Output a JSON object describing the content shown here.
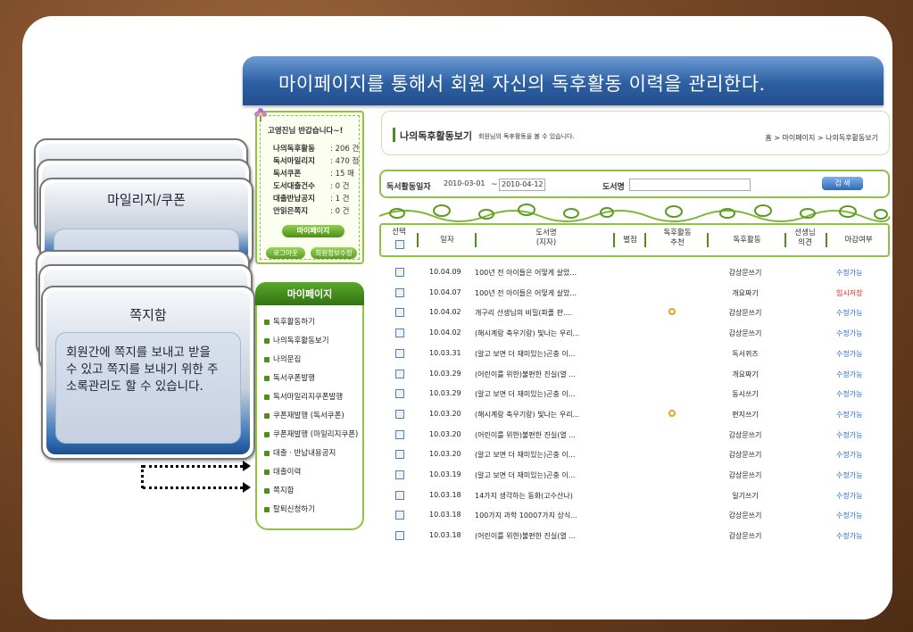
{
  "banner": {
    "title": "마이페이지를 통해서 회원 자신의 독후활동 이력을 관리한다."
  },
  "cards": [
    {
      "title": "마일리지/쿠폰",
      "description": ""
    },
    {
      "title": "쪽지함",
      "description": "회원간에 쪽지를 보내고 받을 수 있고 쪽지를 보내기 위한 주소록관리도 할 수 있습니다."
    }
  ],
  "sidebar": {
    "welcome": "고영진님 반갑습니다~!",
    "stats": [
      {
        "label": "나의독후활동",
        "value": ": 206 건"
      },
      {
        "label": "독서마일리지",
        "value": ": 470 점"
      },
      {
        "label": "독서쿠폰",
        "value": ": 15 매"
      },
      {
        "label": "도서대출건수",
        "value": ": 0 건"
      },
      {
        "label": "대출반납공지",
        "value": ": 1 건"
      },
      {
        "label": "안읽은쪽지",
        "value": ": 0 건"
      }
    ],
    "mypage_button": "마이페이지",
    "logout_button": "로그아웃",
    "edit_info_button": "회원정보수정",
    "menu_title": "마이페이지",
    "menu_items": [
      "독후활동하기",
      "나의독후활동보기",
      "나의문집",
      "독서쿠폰발행",
      "독서마일리지쿠폰발행",
      "쿠폰재발행 (독서쿠폰)",
      "쿠폰재발행 (마일리지쿠폰)",
      "대출ㆍ반납내용공지",
      "대출이력",
      "쪽지함",
      "탈퇴신청하기"
    ]
  },
  "header": {
    "title": "나의독후활동보기",
    "subtitle": "회원님의 독후활동을 볼 수 있습니다.",
    "breadcrumb": "홈 > 마이페이지 > 나의독후활동보기"
  },
  "search": {
    "period_label": "독서활동일자",
    "date_from": "2010-03-01",
    "separator": "~",
    "date_to": "2010-04-12",
    "book_label": "도서명",
    "book_value": "",
    "button": "검 색"
  },
  "table": {
    "columns": [
      "선택",
      "일자",
      "도서명\n(지자)",
      "별점",
      "독후활동\n추천",
      "독후활동",
      "선생님\n의견",
      "마감여부"
    ],
    "rows": [
      {
        "date": "10.04.09",
        "book": "100년 전 아이들은 어떻게 살았...",
        "recommended": false,
        "activity": "감상문쓰기",
        "status": "수정가능",
        "status_type": "ok"
      },
      {
        "date": "10.04.07",
        "book": "100년 전 아이들은 어떻게 살았...",
        "recommended": false,
        "activity": "개요짜기",
        "status": "임시저장",
        "status_type": "temp"
      },
      {
        "date": "10.04.02",
        "book": "개구리 선생님의 비밀(파폴 판....",
        "recommended": true,
        "activity": "감상문쓰기",
        "status": "수정가능",
        "status_type": "ok"
      },
      {
        "date": "10.04.02",
        "book": "(해시계랑 축우기랑) 빛나는 우리...",
        "recommended": false,
        "activity": "감상문쓰기",
        "status": "수정가능",
        "status_type": "ok"
      },
      {
        "date": "10.03.31",
        "book": "(알고 보면 더 재미있는)곤충 이...",
        "recommended": false,
        "activity": "독서퀴즈",
        "status": "수정가능",
        "status_type": "ok"
      },
      {
        "date": "10.03.29",
        "book": "(어린이를 위한)불편한 진실(열 ...",
        "recommended": false,
        "activity": "개요짜기",
        "status": "수정가능",
        "status_type": "ok"
      },
      {
        "date": "10.03.29",
        "book": "(알고 보면 더 재미있는)곤충 이...",
        "recommended": false,
        "activity": "동시쓰기",
        "status": "수정가능",
        "status_type": "ok"
      },
      {
        "date": "10.03.20",
        "book": "(해시계랑 축우기랑) 빛나는 우리...",
        "recommended": true,
        "activity": "편지쓰기",
        "status": "수정가능",
        "status_type": "ok"
      },
      {
        "date": "10.03.20",
        "book": "(어린이를 위한)불편한 진실(열 ...",
        "recommended": false,
        "activity": "감상문쓰기",
        "status": "수정가능",
        "status_type": "ok"
      },
      {
        "date": "10.03.20",
        "book": "(알고 보면 더 재미있는)곤충 이...",
        "recommended": false,
        "activity": "감상문쓰기",
        "status": "수정가능",
        "status_type": "ok"
      },
      {
        "date": "10.03.19",
        "book": "(알고 보면 더 재미있는)곤충 이...",
        "recommended": false,
        "activity": "감상문쓰기",
        "status": "수정가능",
        "status_type": "ok"
      },
      {
        "date": "10.03.18",
        "book": "14가지 생각하는 동화(고수산나)",
        "recommended": false,
        "activity": "일기쓰기",
        "status": "수정가능",
        "status_type": "ok"
      },
      {
        "date": "10.03.18",
        "book": "100가지 과학 10007가지 상식...",
        "recommended": false,
        "activity": "감상문쓰기",
        "status": "수정가능",
        "status_type": "ok"
      },
      {
        "date": "10.03.18",
        "book": "(어린이를 위한)불편한 진실(열 ...",
        "recommended": false,
        "activity": "감상문쓰기",
        "status": "수정가능",
        "status_type": "ok"
      }
    ]
  },
  "colors": {
    "banner": "#2c5fa3",
    "green": "#4f8e1a",
    "status_ok": "#2a6fd8",
    "status_temp": "#e02020",
    "recommend_dot": "#f0a020"
  }
}
